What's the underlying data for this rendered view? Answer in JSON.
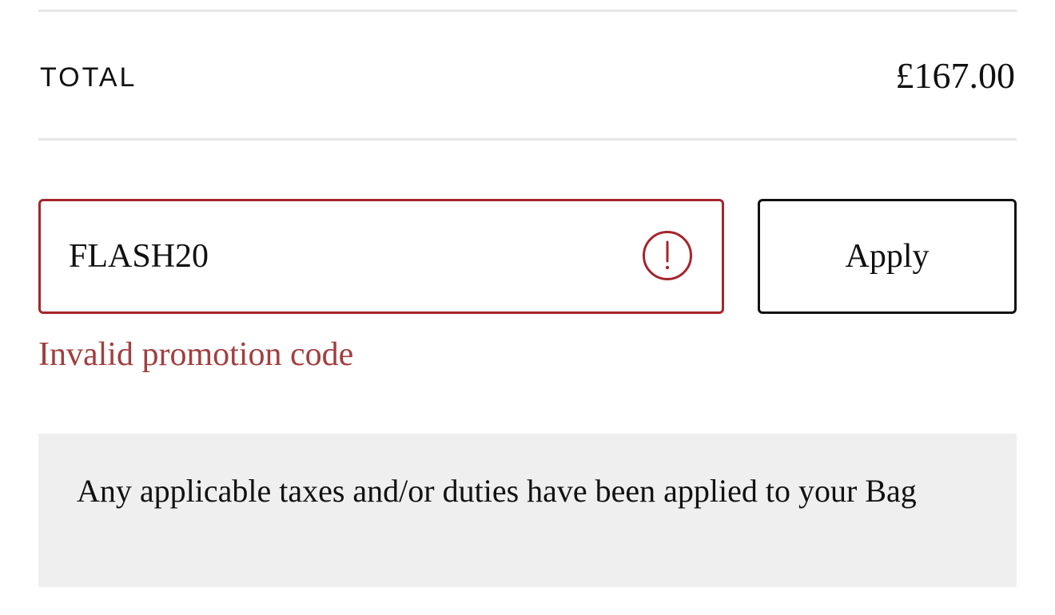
{
  "summary": {
    "total_label": "TOTAL",
    "total_value": "£167.00"
  },
  "promo": {
    "value": "FLASH20",
    "apply_label": "Apply",
    "error_text": "Invalid promotion code",
    "error_icon": "exclamation-circle-icon",
    "error_color": "#a4262c"
  },
  "notice": {
    "text": "Any applicable taxes and/or duties have been applied to your Bag"
  }
}
